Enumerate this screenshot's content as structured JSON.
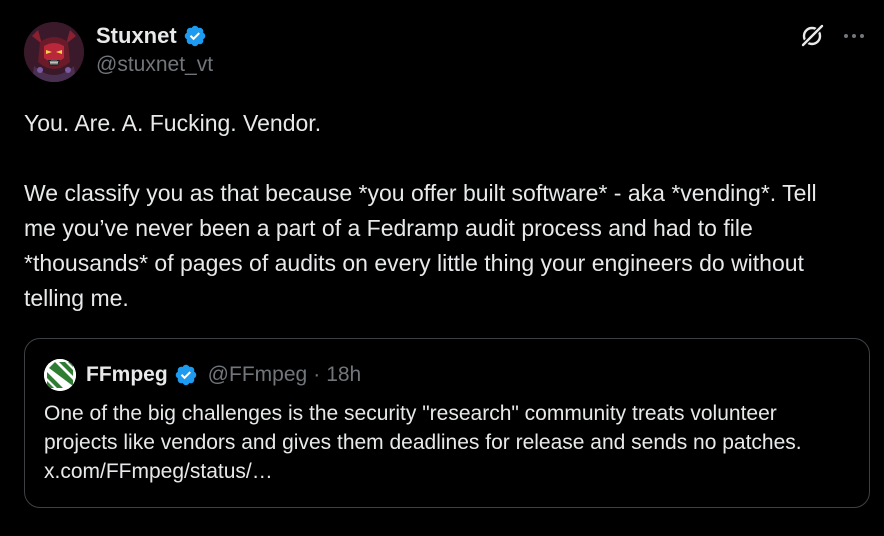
{
  "author": {
    "display_name": "Stuxnet",
    "handle": "@stuxnet_vt",
    "verified": true,
    "avatar_icon": "demon-mech-avatar"
  },
  "actions": {
    "grok_icon": "grok-icon",
    "more_icon": "more-icon"
  },
  "tweet": {
    "line1": "You. Are. A. Fucking. Vendor.",
    "line2": "We classify you as that because *you offer built software* - aka *vending*. Tell me you’ve never been a part of a Fedramp audit process and had to file *thousands* of pages of audits on every little thing your engineers do without telling me."
  },
  "quote": {
    "display_name": "FFmpeg",
    "handle": "@FFmpeg",
    "separator": "·",
    "time": "18h",
    "verified": true,
    "avatar_icon": "ffmpeg-logo",
    "text": "One of the big challenges is the security \"research\" community treats volunteer projects like vendors and gives them deadlines for release and sends no patches.",
    "link": "x.com/FFmpeg/status/…"
  },
  "colors": {
    "background": "#000000",
    "text": "#e7e9ea",
    "secondary": "#71767b",
    "verified_blue": "#1d9bf0",
    "border": "#3e4144",
    "ffmpeg_green": "#2e7d32"
  }
}
